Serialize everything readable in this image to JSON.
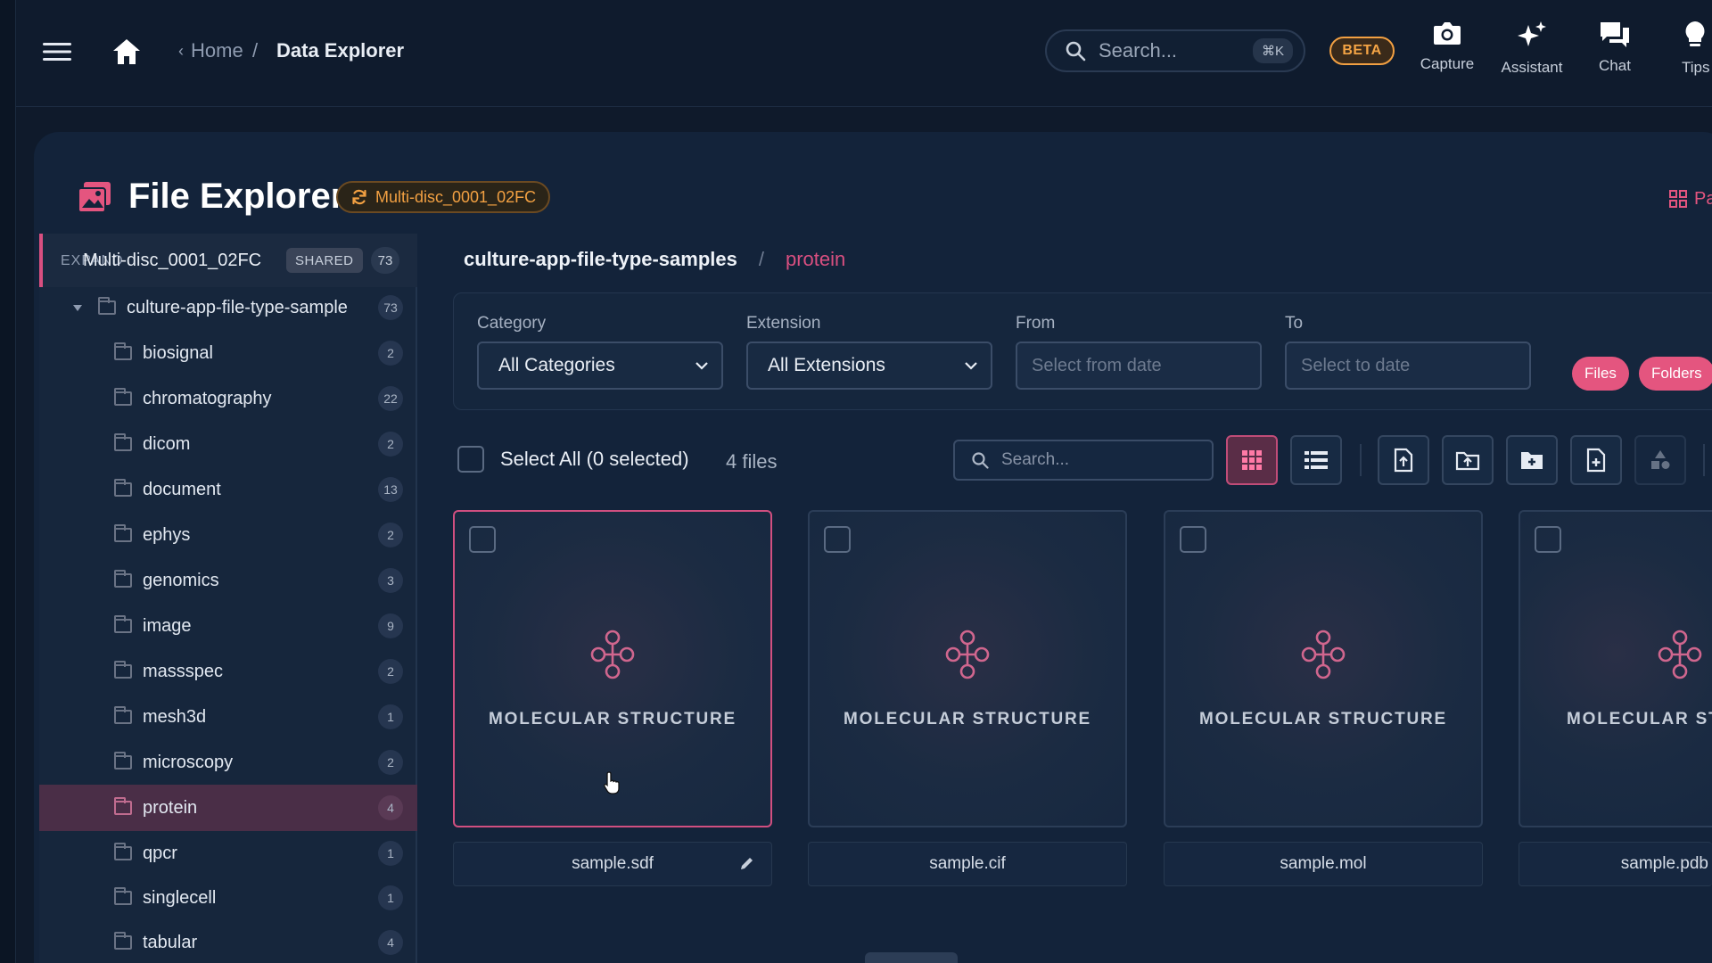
{
  "header": {
    "breadcrumb_home": "Home",
    "breadcrumb_sep": "/",
    "breadcrumb_current": "Data Explorer",
    "search_placeholder": "Search...",
    "search_shortcut": "⌘K",
    "beta_label": "BETA",
    "tools": [
      {
        "label": "Capture",
        "icon": "camera-icon"
      },
      {
        "label": "Assistant",
        "icon": "sparkle-icon"
      },
      {
        "label": "Chat",
        "icon": "chat-icon"
      },
      {
        "label": "Tips",
        "icon": "lightbulb-icon"
      }
    ]
  },
  "explorer": {
    "title": "File Explorer",
    "dataset_chip": "Multi-disc_0001_02FC",
    "panels_link_partial": "Pa"
  },
  "sidebar": {
    "root": {
      "overlap_text": "EXPAND",
      "name": "Multi-disc_0001_02FC",
      "badge": "SHARED",
      "count": "73"
    },
    "parent": {
      "label": "culture-app-file-type-sample",
      "count": "73"
    },
    "folders": [
      {
        "label": "biosignal",
        "count": "2"
      },
      {
        "label": "chromatography",
        "count": "22"
      },
      {
        "label": "dicom",
        "count": "2"
      },
      {
        "label": "document",
        "count": "13"
      },
      {
        "label": "ephys",
        "count": "2"
      },
      {
        "label": "genomics",
        "count": "3"
      },
      {
        "label": "image",
        "count": "9"
      },
      {
        "label": "massspec",
        "count": "2"
      },
      {
        "label": "mesh3d",
        "count": "1"
      },
      {
        "label": "microscopy",
        "count": "2"
      },
      {
        "label": "protein",
        "count": "4"
      },
      {
        "label": "qpcr",
        "count": "1"
      },
      {
        "label": "singlecell",
        "count": "1"
      },
      {
        "label": "tabular",
        "count": "4"
      }
    ],
    "active_folder": "protein"
  },
  "path": {
    "root": "culture-app-file-type-samples",
    "sep": "/",
    "current": "protein"
  },
  "filters": {
    "category_label": "Category",
    "category_value": "All Categories",
    "extension_label": "Extension",
    "extension_value": "All Extensions",
    "from_label": "From",
    "from_placeholder": "Select from date",
    "to_label": "To",
    "to_placeholder": "Select to date",
    "files_pill": "Files",
    "folders_pill": "Folders"
  },
  "toolbar": {
    "select_all": "Select All (0 selected)",
    "file_count": "4 files",
    "search_placeholder": "Search..."
  },
  "files": [
    {
      "type": "MOLECULAR STRUCTURE",
      "name": "sample.sdf",
      "selected": true
    },
    {
      "type": "MOLECULAR STRUCTURE",
      "name": "sample.cif",
      "selected": false
    },
    {
      "type": "MOLECULAR STRUCTURE",
      "name": "sample.mol",
      "selected": false
    },
    {
      "type": "MOLECULAR STRUCTURE",
      "name": "sample.pdb",
      "selected": false
    }
  ],
  "colors": {
    "accent": "#e4557f",
    "warning": "#f2a042",
    "background": "#0f1a2b"
  }
}
